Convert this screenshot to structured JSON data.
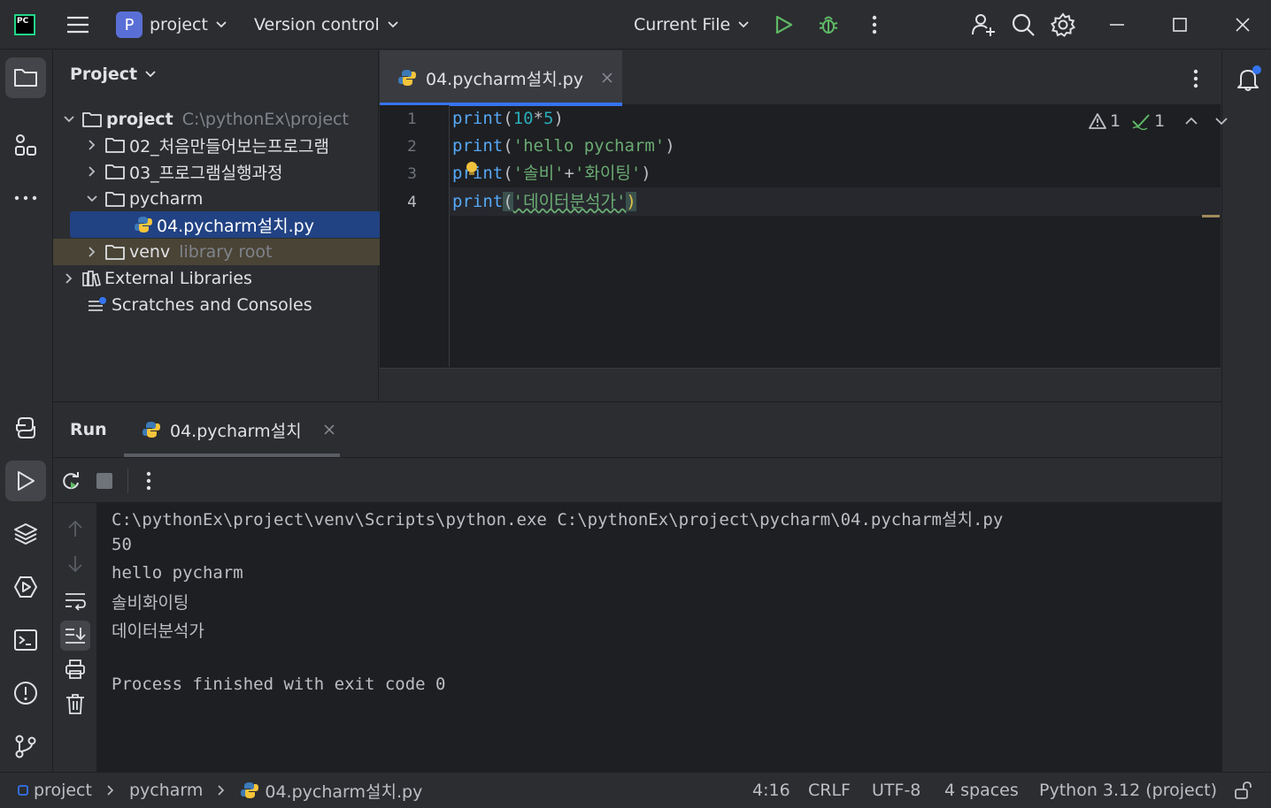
{
  "titlebar": {
    "app_logo_text": "PC",
    "project_badge": "P",
    "project_name": "project",
    "version_control": "Version control",
    "run_config": "Current File"
  },
  "project_panel": {
    "title": "Project",
    "tree": [
      {
        "label": "project",
        "hint": "C:\\pythonEx\\project"
      },
      {
        "label": "02_처음만들어보는프로그램",
        "hint": ""
      },
      {
        "label": "03_프로그램실행과정",
        "hint": ""
      },
      {
        "label": "pycharm",
        "hint": ""
      },
      {
        "label": "04.pycharm설치.py",
        "hint": ""
      },
      {
        "label": "venv",
        "hint": "library root"
      },
      {
        "label": "External Libraries",
        "hint": ""
      },
      {
        "label": "Scratches and Consoles",
        "hint": ""
      }
    ]
  },
  "editor": {
    "tab_label": "04.pycharm설치.py",
    "warnings": "1",
    "weak_warnings": "1",
    "line_numbers": [
      "1",
      "2",
      "3",
      "4"
    ],
    "lines": [
      {
        "fn": "print",
        "open": "(",
        "a": "10",
        "op": "*",
        "b": "5",
        "close": ")"
      },
      {
        "fn": "print",
        "open": "(",
        "s": "'hello pycharm'",
        "close": ")"
      },
      {
        "fn": "print",
        "open": "(",
        "s1": "'솔비'",
        "op": "+",
        "s2": "'화이팅'",
        "close": ")"
      },
      {
        "fn": "print",
        "open": "(",
        "s": "'데이터분석가'",
        "close": ")"
      }
    ]
  },
  "run_panel": {
    "title": "Run",
    "tab_label": "04.pycharm설치",
    "output": [
      "C:\\pythonEx\\project\\venv\\Scripts\\python.exe C:\\pythonEx\\project\\pycharm\\04.pycharm설치.py",
      "50",
      "hello pycharm",
      "솔비화이팅",
      "데이터분석가",
      "",
      "Process finished with exit code 0"
    ]
  },
  "statusbar": {
    "crumb1": "project",
    "crumb2": "pycharm",
    "crumb3": "04.pycharm설치.py",
    "position": "4:16",
    "line_sep": "CRLF",
    "encoding": "UTF-8",
    "indent": "4 spaces",
    "interpreter": "Python 3.12 (project)"
  },
  "colors": {
    "accent": "#3574f0",
    "run_green": "#5fb865",
    "warning": "#f0a732"
  }
}
